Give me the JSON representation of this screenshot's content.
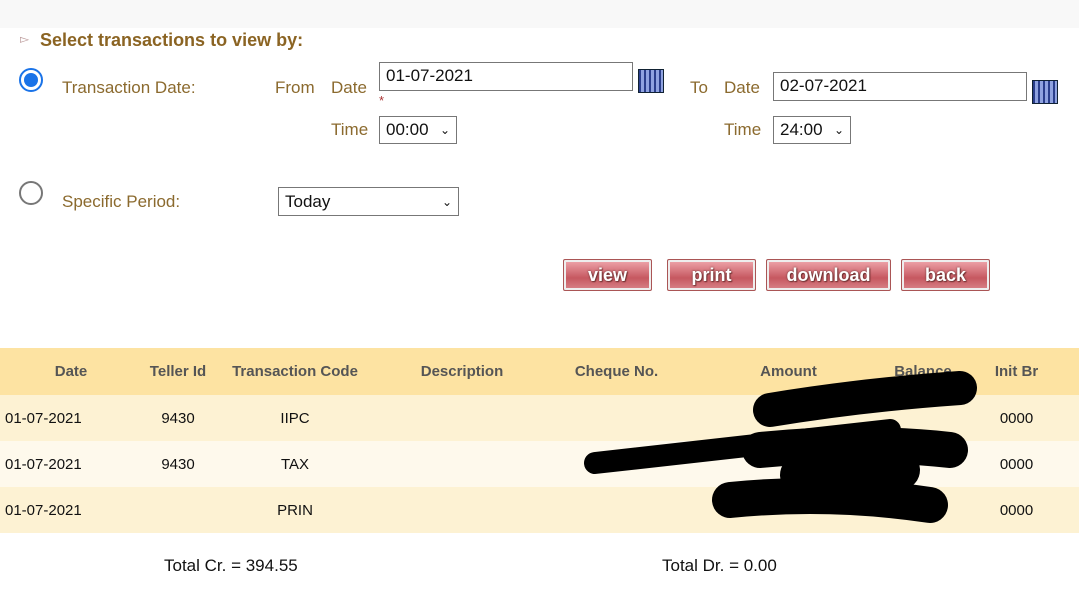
{
  "title": "Select transactions to view by:",
  "transaction_date": {
    "label": "Transaction Date:",
    "selected": true,
    "from_label": "From",
    "date_label": "Date",
    "from_date": "01-07-2021",
    "required_mark": "*",
    "time_label": "Time",
    "from_time": "00:00",
    "to_label": "To",
    "to_date": "02-07-2021",
    "to_time": "24:00"
  },
  "specific_period": {
    "label": "Specific Period:",
    "selected": false,
    "value": "Today"
  },
  "buttons": {
    "view": "view",
    "print": "print",
    "download": "download",
    "back": "back"
  },
  "table": {
    "headers": [
      "Date",
      "Teller Id",
      "Transaction Code",
      "Description",
      "Cheque No.",
      "Amount",
      "Balance",
      "Init Br"
    ],
    "rows": [
      [
        "01-07-2021",
        "9430",
        "IIPC",
        "",
        "",
        "",
        "",
        "0000"
      ],
      [
        "01-07-2021",
        "9430",
        "TAX",
        "",
        "",
        "",
        "",
        "0000"
      ],
      [
        "01-07-2021",
        "",
        "PRIN",
        "",
        "",
        "",
        "",
        "0000"
      ]
    ]
  },
  "totals": {
    "credit": "Total Cr. = 394.55",
    "debit": "Total Dr. = 0.00"
  },
  "colors": {
    "label": "#8b6a2e",
    "header_bg": "#fde3a2",
    "button": "#c65860",
    "radio": "#1a73e8"
  }
}
